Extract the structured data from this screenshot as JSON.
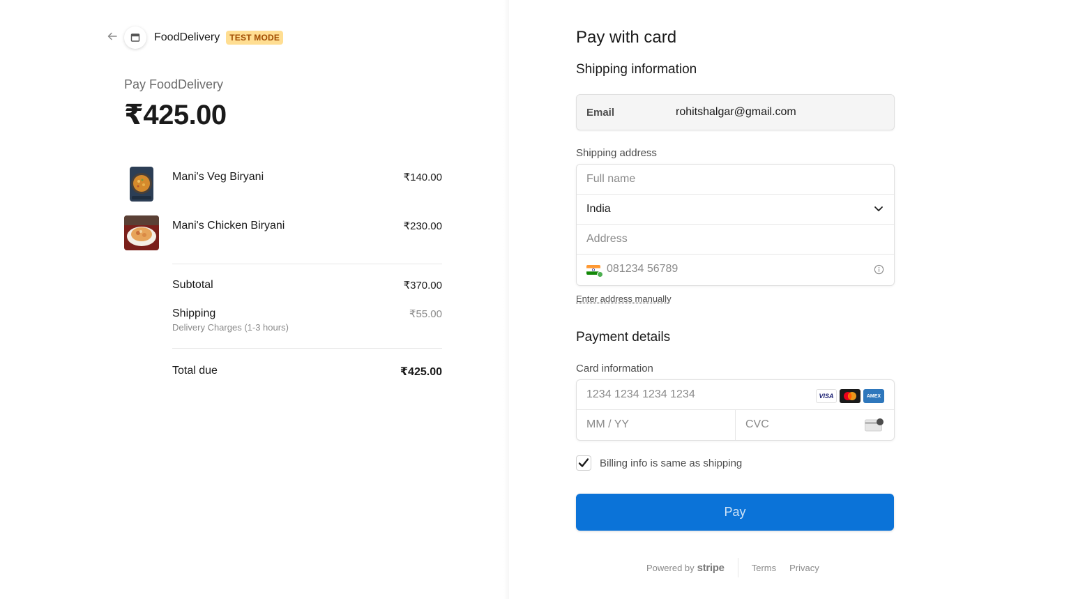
{
  "merchant": {
    "name": "FoodDelivery",
    "badge": "TEST MODE"
  },
  "summary": {
    "pay_label": "Pay FoodDelivery",
    "amount": "₹425.00",
    "items": [
      {
        "name": "Mani's Veg Biryani",
        "price": "₹140.00"
      },
      {
        "name": "Mani's Chicken Biryani",
        "price": "₹230.00"
      }
    ],
    "subtotal_label": "Subtotal",
    "subtotal_value": "₹370.00",
    "shipping_label": "Shipping",
    "shipping_sub": "Delivery Charges (1-3 hours)",
    "shipping_value": "₹55.00",
    "total_label": "Total due",
    "total_value": "₹425.00"
  },
  "form": {
    "title": "Pay with card",
    "shipping_heading": "Shipping information",
    "email_label": "Email",
    "email_value": "rohitshalgar@gmail.com",
    "shipping_address_label": "Shipping address",
    "full_name_placeholder": "Full name",
    "country": "India",
    "address_placeholder": "Address",
    "phone_placeholder": "081234 56789",
    "enter_manually": "Enter address manually",
    "payment_heading": "Payment details",
    "card_info_label": "Card information",
    "card_number_placeholder": "1234 1234 1234 1234",
    "expiry_placeholder": "MM / YY",
    "cvc_placeholder": "CVC",
    "card_brands": [
      "VISA",
      "mastercard",
      "AMEX"
    ],
    "billing_same_label": "Billing info is same as shipping",
    "billing_same_checked": true,
    "pay_button": "Pay"
  },
  "footer": {
    "powered_by": "Powered by",
    "brand": "stripe",
    "terms": "Terms",
    "privacy": "Privacy"
  },
  "colors": {
    "primary": "#0b73d8",
    "badge_bg": "#ffde92",
    "badge_text": "#a04b00"
  }
}
